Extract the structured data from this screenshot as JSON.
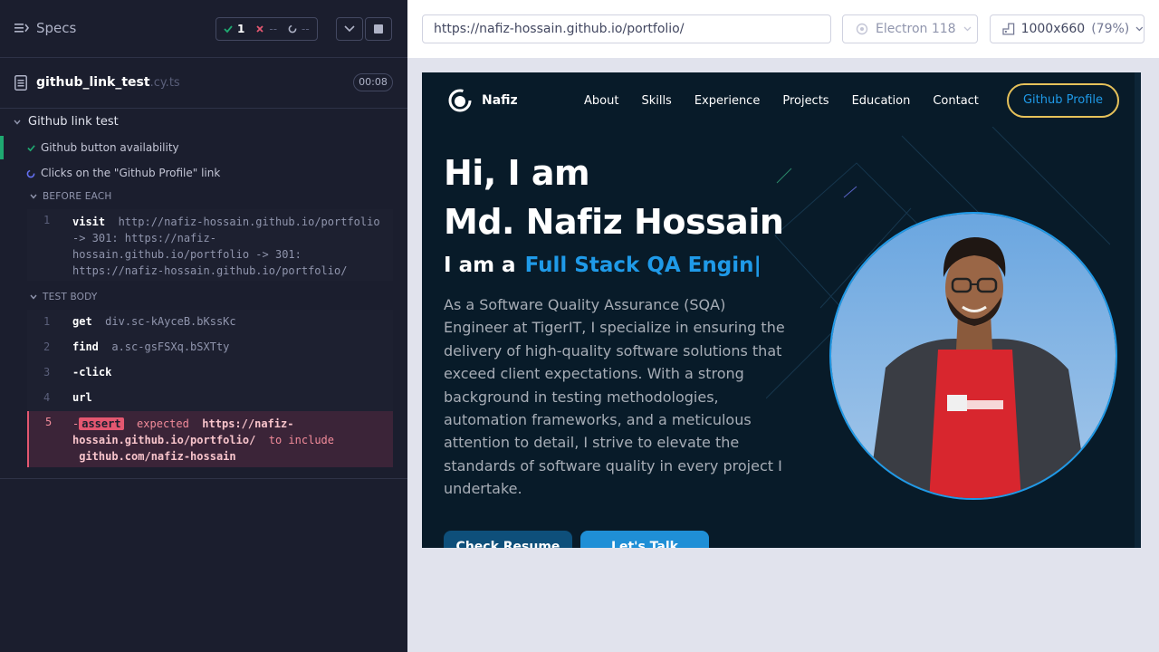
{
  "reporter": {
    "specs_label": "Specs",
    "stats": {
      "passed": "1",
      "failed": "--",
      "pending": "--"
    },
    "spec": {
      "name": "github_link_test",
      "ext": ".cy.ts",
      "duration": "00:08"
    },
    "suite": {
      "title": "Github link test"
    },
    "tests": [
      {
        "title": "Github button availability",
        "state": "passed"
      },
      {
        "title": "Clicks on the \"Github Profile\" link",
        "state": "running"
      }
    ],
    "before_each": {
      "label": "BEFORE EACH",
      "commands": [
        {
          "num": "1",
          "name": "visit",
          "lines": [
            "http://nafiz-hossain.github.io/portfolio",
            "-> 301: https://nafiz-",
            "hossain.github.io/portfolio -> 301:",
            "https://nafiz-hossain.github.io/portfolio/"
          ]
        }
      ]
    },
    "test_body": {
      "label": "TEST BODY",
      "commands": [
        {
          "num": "1",
          "name": "get",
          "message": "div.sc-kAyceB.bKssKc"
        },
        {
          "num": "2",
          "name": "find",
          "message": "a.sc-gsFSXq.bSXTty"
        },
        {
          "num": "3",
          "name": "-click",
          "message": ""
        },
        {
          "num": "4",
          "name": "url",
          "message": ""
        }
      ],
      "failed_command": {
        "num": "5",
        "prefix": "-",
        "badge": "assert",
        "expected": "expected",
        "url_line1": "https://nafiz-",
        "url_line2": "hossain.github.io/portfolio/",
        "to_include": "to include",
        "target": "github.com/nafiz-hossain"
      }
    }
  },
  "aut": {
    "url": "https://nafiz-hossain.github.io/portfolio/",
    "browser": "Electron 118",
    "viewport": "1000x660",
    "zoom": "(79%)"
  },
  "site": {
    "logo_text": "Nafiz",
    "nav": [
      "About",
      "Skills",
      "Experience",
      "Projects",
      "Education",
      "Contact"
    ],
    "github_button": "Github Profile",
    "hero_line1": "Hi, I am",
    "hero_line2": "Md. Nafiz Hossain",
    "role_prefix": "I am a",
    "role_typed": "Full Stack QA Engin|",
    "description": "As a Software Quality Assurance (SQA) Engineer at TigerIT, I specialize in ensuring the delivery of high-quality software solutions that exceed client expectations. With a strong background in testing methodologies, automation frameworks, and a meticulous attention to detail, I strive to elevate the standards of software quality in every project I undertake.",
    "cta_resume": "Check Resume",
    "cta_talk": "Let's Talk"
  },
  "colors": {
    "reporter_bg": "#1b1e2e",
    "pass_green": "#1fa971",
    "fail_red": "#e45770",
    "site_bg": "#081b29",
    "accent_blue": "#1f9ae8",
    "button_border_gold": "#e6c15a"
  },
  "icons": [
    "specs-icon",
    "check-icon",
    "x-icon",
    "spinner-icon",
    "chevron-down-icon",
    "stop-icon",
    "document-icon",
    "browser-icon",
    "viewport-icon",
    "logo-icon"
  ]
}
